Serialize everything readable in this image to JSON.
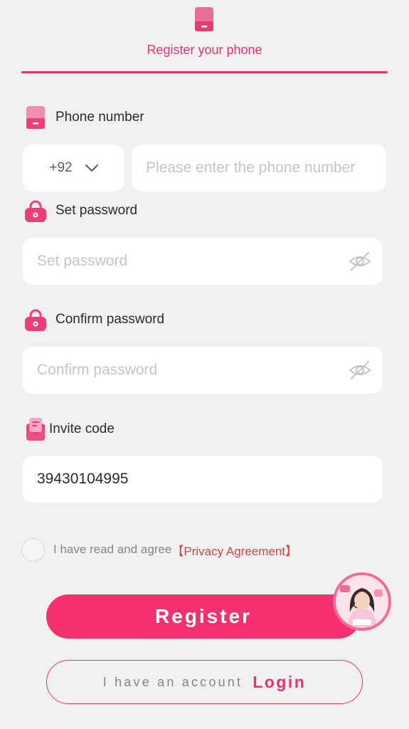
{
  "tab": {
    "label": "Register your phone",
    "icon": "phone-icon"
  },
  "phone": {
    "label": "Phone number",
    "country_code": "+92",
    "placeholder": "Please enter the phone number",
    "value": ""
  },
  "password": {
    "label": "Set password",
    "placeholder": "Set password",
    "value": ""
  },
  "confirm_password": {
    "label": "Confirm password",
    "placeholder": "Confirm password",
    "value": ""
  },
  "invite": {
    "label": "Invite code",
    "value": "39430104995"
  },
  "agreement": {
    "text": "I have read and agree",
    "link": "【Privacy Agreement】",
    "checked": false
  },
  "buttons": {
    "register": "Register",
    "have_account": "I have an account",
    "login": "Login"
  },
  "colors": {
    "accent": "#e8336f",
    "register_bg": "#f4306f",
    "background": "#f2f1ef"
  }
}
